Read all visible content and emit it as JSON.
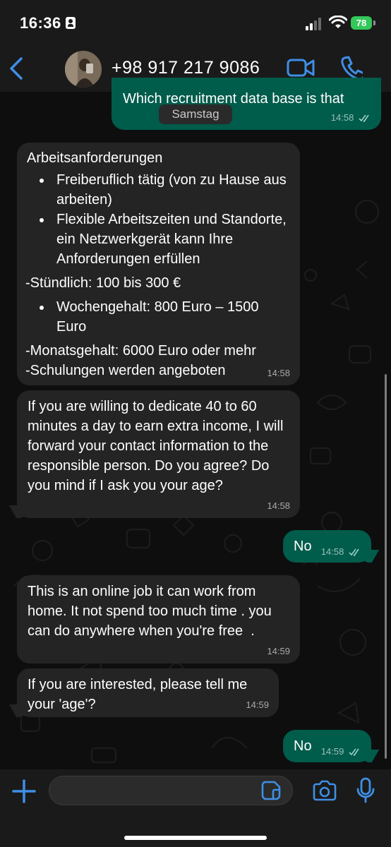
{
  "status_bar": {
    "time": "16:36",
    "battery": "78"
  },
  "header": {
    "contact": "+98 917 217 9086"
  },
  "messages": {
    "m0": {
      "text": "Which recruitment data base is that",
      "time": "14:58"
    },
    "date_chip": "Samstag",
    "m1": {
      "title": "Arbeitsanforderungen",
      "bullets": [
        "Freiberuflich tätig (von zu Hause aus arbeiten)",
        "Flexible Arbeitszeiten und Standorte, ein Netzwerkgerät kann Ihre Anforderungen erfüllen"
      ],
      "line1": "-Stündlich: 100 bis 300 €",
      "bullet3": "Wochengehalt: 800 Euro – 1500 Euro",
      "line2": "-Monatsgehalt: 6000 Euro oder mehr",
      "line3": "-Schulungen werden angeboten",
      "time": "14:58"
    },
    "m2": {
      "text": "If you are willing to dedicate 40 to 60 minutes a day to earn extra income, I will forward your contact information to the responsible person. Do you agree? Do you mind if I ask you your age?",
      "time": "14:58"
    },
    "m3": {
      "text": "No",
      "time": "14:58"
    },
    "m4": {
      "text": "This is an online job it can work from home. It not spend too much time . you can do anywhere when you're free  .",
      "time": "14:59"
    },
    "m5": {
      "text": "If you are interested, please tell me your 'age'?",
      "time": "14:59"
    },
    "m6": {
      "text": "No",
      "time": "14:59"
    }
  },
  "composer": {
    "placeholder": ""
  },
  "colors": {
    "incoming": "#242424",
    "outgoing": "#005c4b",
    "accent": "#3e8fe6"
  },
  "icons": [
    "id-card-icon",
    "signal-icon",
    "wifi-icon",
    "battery-icon",
    "back-chevron-icon",
    "video-call-icon",
    "phone-icon",
    "plus-icon",
    "sticker-icon",
    "camera-icon",
    "microphone-icon",
    "read-ticks-icon"
  ]
}
